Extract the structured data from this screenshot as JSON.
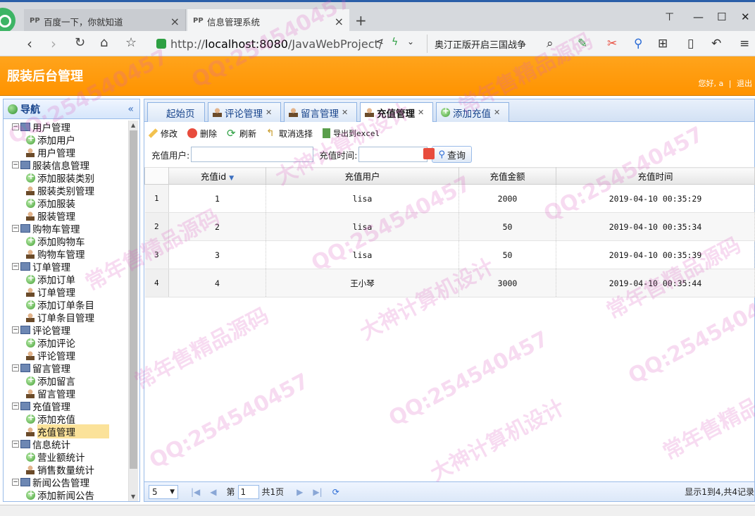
{
  "browser": {
    "tabs": [
      {
        "label": "百度一下，你就知道",
        "favicon": "PP",
        "active": false
      },
      {
        "label": "信息管理系统",
        "favicon": "PP",
        "active": true
      }
    ],
    "url": "http://localhost:8080/JavaWebProject/",
    "search_text": "奥汀正版开启三国战争"
  },
  "app": {
    "title": "服装后台管理",
    "greeting": "您好, a",
    "separator": "|",
    "logout": "退出"
  },
  "nav": {
    "title": "导航",
    "groups": [
      {
        "label": "用户管理",
        "items": [
          {
            "label": "添加用户",
            "type": "add"
          },
          {
            "label": "用户管理",
            "type": "manage"
          }
        ]
      },
      {
        "label": "服装信息管理",
        "items": [
          {
            "label": "添加服装类别",
            "type": "add"
          },
          {
            "label": "服装类别管理",
            "type": "manage"
          },
          {
            "label": "添加服装",
            "type": "add"
          },
          {
            "label": "服装管理",
            "type": "manage"
          }
        ]
      },
      {
        "label": "购物车管理",
        "items": [
          {
            "label": "添加购物车",
            "type": "add"
          },
          {
            "label": "购物车管理",
            "type": "manage"
          }
        ]
      },
      {
        "label": "订单管理",
        "items": [
          {
            "label": "添加订单",
            "type": "add"
          },
          {
            "label": "订单管理",
            "type": "manage"
          },
          {
            "label": "添加订单条目",
            "type": "add"
          },
          {
            "label": "订单条目管理",
            "type": "manage"
          }
        ]
      },
      {
        "label": "评论管理",
        "items": [
          {
            "label": "添加评论",
            "type": "add"
          },
          {
            "label": "评论管理",
            "type": "manage"
          }
        ]
      },
      {
        "label": "留言管理",
        "items": [
          {
            "label": "添加留言",
            "type": "add"
          },
          {
            "label": "留言管理",
            "type": "manage"
          }
        ]
      },
      {
        "label": "充值管理",
        "items": [
          {
            "label": "添加充值",
            "type": "add"
          },
          {
            "label": "充值管理",
            "type": "manage",
            "selected": true
          }
        ]
      },
      {
        "label": "信息统计",
        "items": [
          {
            "label": "营业额统计",
            "type": "add"
          },
          {
            "label": "销售数量统计",
            "type": "manage"
          }
        ]
      },
      {
        "label": "新闻公告管理",
        "items": [
          {
            "label": "添加新闻公告",
            "type": "add"
          }
        ]
      }
    ]
  },
  "content_tabs": [
    {
      "label": "起始页",
      "closable": false,
      "active": false
    },
    {
      "label": "评论管理",
      "closable": true,
      "active": false
    },
    {
      "label": "留言管理",
      "closable": true,
      "active": false
    },
    {
      "label": "充值管理",
      "closable": true,
      "active": true
    },
    {
      "label": "添加充值",
      "closable": true,
      "active": false
    }
  ],
  "toolbar": {
    "edit": "修改",
    "delete": "删除",
    "refresh": "刷新",
    "cancel_select": "取消选择",
    "export": "导出到excel"
  },
  "search": {
    "user_label": "充值用户:",
    "time_label": "充值时间:",
    "query_button": "查询"
  },
  "grid": {
    "columns": [
      "充值id",
      "充值用户",
      "充值金额",
      "充值时间"
    ],
    "rows": [
      {
        "rownum": "1",
        "id": "1",
        "user": "lisa",
        "amount": "2000",
        "time": "2019-04-10 00:35:29"
      },
      {
        "rownum": "2",
        "id": "2",
        "user": "lisa",
        "amount": "50",
        "time": "2019-04-10 00:35:34"
      },
      {
        "rownum": "3",
        "id": "3",
        "user": "lisa",
        "amount": "50",
        "time": "2019-04-10 00:35:39"
      },
      {
        "rownum": "4",
        "id": "4",
        "user": "王小琴",
        "amount": "3000",
        "time": "2019-04-10 00:35:44"
      }
    ]
  },
  "pager": {
    "page_size": "5",
    "page_prefix": "第",
    "current_page": "1",
    "total_pages": "共1页",
    "info": "显示1到4,共4记录"
  },
  "watermarks": [
    "QQ:254540457",
    "常年售精品源码",
    "大神计算机设计"
  ]
}
